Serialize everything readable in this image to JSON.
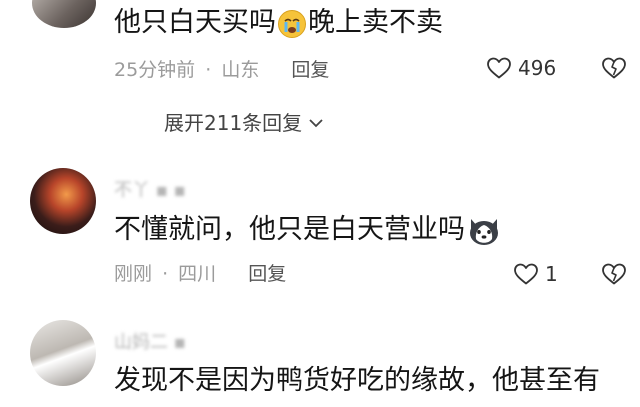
{
  "comments": [
    {
      "text": "他只白天买吗",
      "text_after_emoji": "晚上卖不卖",
      "emoji": "crying-face",
      "time": "25分钟前",
      "location": "山东",
      "reply_label": "回复",
      "likes": "496"
    },
    {
      "username": "不丫 ▪ ▪",
      "text": "不懂就问，他只是白天营业吗",
      "emoji": "husky-dog-face",
      "time": "刚刚",
      "location": "四川",
      "reply_label": "回复",
      "likes": "1"
    },
    {
      "username": "山妈二 ▪",
      "text": "发现不是因为鸭货好吃的缘故，他甚至有"
    }
  ],
  "expand_replies": "展开211条回复",
  "separator": "·"
}
